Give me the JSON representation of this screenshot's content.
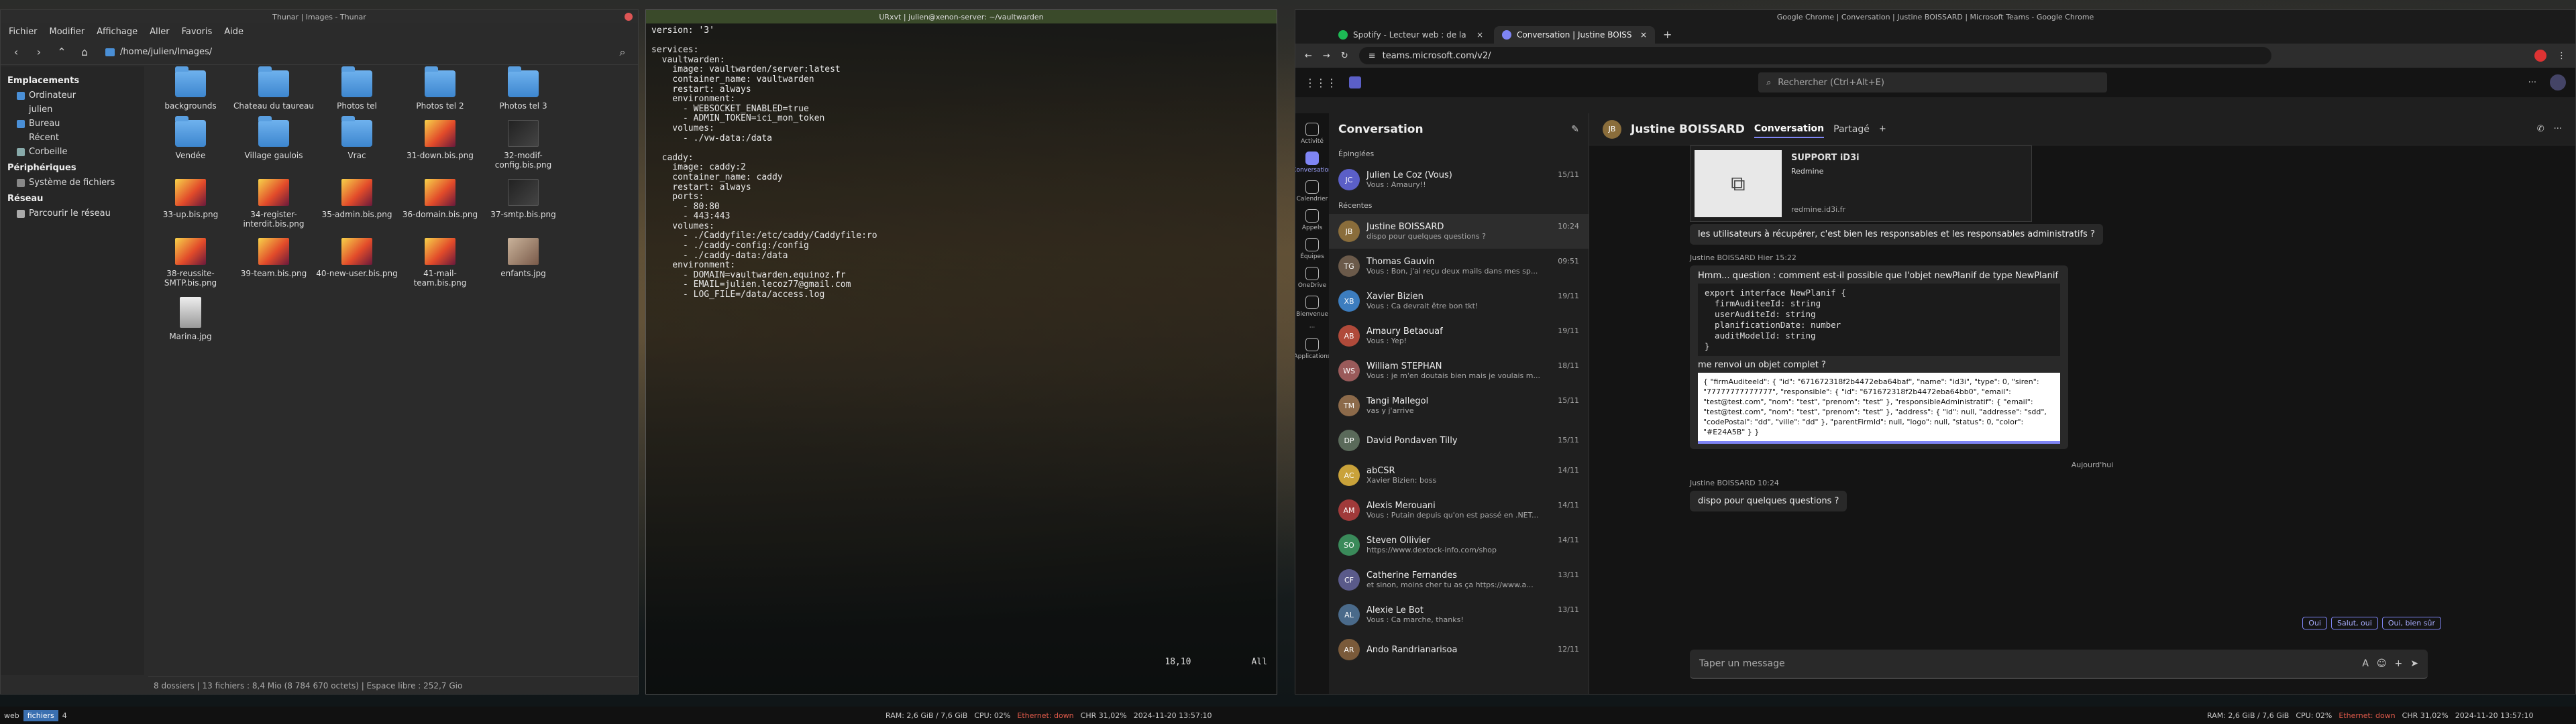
{
  "thunar": {
    "title": "Thunar | Images - Thunar",
    "menu": [
      "Fichier",
      "Modifier",
      "Affichage",
      "Aller",
      "Favoris",
      "Aide"
    ],
    "path": "/home/julien/Images/",
    "sidebar": {
      "places_title": "Emplacements",
      "places": [
        "Ordinateur",
        "julien",
        "Bureau",
        "Récent",
        "Corbeille"
      ],
      "devices_title": "Périphériques",
      "devices": [
        "Système de fichiers"
      ],
      "network_title": "Réseau",
      "network": [
        "Parcourir le réseau"
      ]
    },
    "files": [
      {
        "name": "backgrounds",
        "kind": "folder"
      },
      {
        "name": "Chateau du taureau",
        "kind": "folder"
      },
      {
        "name": "Photos tel",
        "kind": "folder"
      },
      {
        "name": "Photos tel 2",
        "kind": "folder"
      },
      {
        "name": "Photos tel 3",
        "kind": "folder"
      },
      {
        "name": "",
        "kind": "none"
      },
      {
        "name": "Vendée",
        "kind": "folder"
      },
      {
        "name": "Village gaulois",
        "kind": "folder"
      },
      {
        "name": "Vrac",
        "kind": "folder"
      },
      {
        "name": "31-down.bis.png",
        "kind": "img"
      },
      {
        "name": "32-modif-config.bis.png",
        "kind": "dark"
      },
      {
        "name": "",
        "kind": "none"
      },
      {
        "name": "33-up.bis.png",
        "kind": "img"
      },
      {
        "name": "34-register-interdit.bis.png",
        "kind": "img"
      },
      {
        "name": "35-admin.bis.png",
        "kind": "img"
      },
      {
        "name": "36-domain.bis.png",
        "kind": "img"
      },
      {
        "name": "37-smtp.bis.png",
        "kind": "dark"
      },
      {
        "name": "",
        "kind": "none"
      },
      {
        "name": "38-reussite-SMTP.bis.png",
        "kind": "img"
      },
      {
        "name": "39-team.bis.png",
        "kind": "img"
      },
      {
        "name": "40-new-user.bis.png",
        "kind": "img"
      },
      {
        "name": "41-mail-team.bis.png",
        "kind": "img"
      },
      {
        "name": "enfants.jpg",
        "kind": "photo"
      },
      {
        "name": "",
        "kind": "none"
      },
      {
        "name": "Marina.jpg",
        "kind": "portrait"
      }
    ],
    "status": "8 dossiers | 13 fichiers : 8,4 Mio (8 784 670 octets) | Espace libre : 252,7 Gio"
  },
  "terminal": {
    "title": "URxvt | julien@xenon-server: ~/vaultwarden",
    "content": "version: '3'\n\nservices:\n  vaultwarden:\n    image: vaultwarden/server:latest\n    container_name: vaultwarden\n    restart: always\n    environment:\n      - WEBSOCKET_ENABLED=true\n      - ADMIN_TOKEN=ici_mon_token\n    volumes:\n      - ./vw-data:/data\n\n  caddy:\n    image: caddy:2\n    container_name: caddy\n    restart: always\n    ports:\n      - 80:80\n      - 443:443\n    volumes:\n      - ./Caddyfile:/etc/caddy/Caddyfile:ro\n      - ./caddy-config:/config\n      - ./caddy-data:/data\n    environment:\n      - DOMAIN=vaultwarden.equinoz.fr\n      - EMAIL=julien.lecoz77@gmail.com\n      - LOG_FILE=/data/access.log",
    "position": "18,10",
    "scroll": "All"
  },
  "chrome": {
    "title": "Google Chrome | Conversation | Justine BOISSARD | Microsoft Teams - Google Chrome",
    "tabs": [
      "Spotify - Lecteur web : de la",
      "Conversation | Justine BOISS"
    ],
    "url": "teams.microsoft.com/v2/"
  },
  "teams": {
    "search_placeholder": "Rechercher (Ctrl+Alt+E)",
    "rail": [
      "Activité",
      "Conversation",
      "Calendrier",
      "Appels",
      "Équipes",
      "OneDrive",
      "Bienvenue",
      "Applications"
    ],
    "list_title": "Conversation",
    "pinned_label": "Épinglées",
    "recent_label": "Récentes",
    "pinned": [
      {
        "initials": "JC",
        "name": "Julien Le Coz (Vous)",
        "preview": "Vous : Amaury!!",
        "time": "15/11",
        "color": "#5b5fc7"
      }
    ],
    "chats": [
      {
        "initials": "JB",
        "name": "Justine BOISSARD",
        "preview": "dispo pour quelques questions ?",
        "time": "10:24",
        "color": "#8a6d3b"
      },
      {
        "initials": "TG",
        "name": "Thomas Gauvin",
        "preview": "Vous : Bon, j'ai reçu deux mails dans mes sp...",
        "time": "09:51",
        "color": "#6b5a4a"
      },
      {
        "initials": "XB",
        "name": "Xavier Bizien",
        "preview": "Vous : Ca devrait être bon tkt!",
        "time": "19/11",
        "color": "#3c7dbf"
      },
      {
        "initials": "AB",
        "name": "Amaury Betaouaf",
        "preview": "Vous : Yep!",
        "time": "19/11",
        "color": "#b04a3a"
      },
      {
        "initials": "WS",
        "name": "William STEPHAN",
        "preview": "Vous : je m'en doutais bien mais je voulais m...",
        "time": "18/11",
        "color": "#9a5a5a"
      },
      {
        "initials": "TM",
        "name": "Tangi Mallegol",
        "preview": "vas y j'arrive",
        "time": "15/11",
        "color": "#8c6a4a"
      },
      {
        "initials": "DP",
        "name": "David Pondaven Tilly",
        "preview": "",
        "time": "15/11",
        "color": "#5a6a5a"
      },
      {
        "initials": "AC",
        "name": "abCSR",
        "preview": "Xavier Bizien: boss",
        "time": "14/11",
        "color": "#c9a23a"
      },
      {
        "initials": "AM",
        "name": "Alexis Merouani",
        "preview": "Vous : Putain depuis qu'on est passé en .NET...",
        "time": "14/11",
        "color": "#a03a3a"
      },
      {
        "initials": "SO",
        "name": "Steven Ollivier",
        "preview": "https://www.dextock-info.com/shop",
        "time": "14/11",
        "color": "#3a8a5a"
      },
      {
        "initials": "CF",
        "name": "Catherine Fernandes",
        "preview": "et sinon, moins cher tu as ça https://www.a...",
        "time": "13/11",
        "color": "#5a5a8a"
      },
      {
        "initials": "AL",
        "name": "Alexie Le Bot",
        "preview": "Vous : Ca marche, thanks!",
        "time": "13/11",
        "color": "#4a6a8a"
      },
      {
        "initials": "AR",
        "name": "Ando Randrianarisoa",
        "preview": "",
        "time": "12/11",
        "color": "#7a5a3a"
      }
    ],
    "conv": {
      "initials": "JB",
      "name": "Justine BOISSARD",
      "tab_conv": "Conversation",
      "tab_share": "Partagé",
      "card_title": "SUPPORT iD3i",
      "card_sub": "Redmine",
      "card_url": "redmine.id3i.fr",
      "msg1": "les utilisateurs à récupérer, c'est bien les responsables et les responsables administratifs ?",
      "meta2": "Justine BOISSARD  Hier 15:22",
      "msg2": "Hmm... question : comment est-il possible que l'objet newPlanif de type NewPlanif",
      "code": "export interface NewPlanif {\n  firmAuditeeId: string\n  userAuditeId: string\n  planificationDate: number\n  auditModelId: string\n}",
      "msg3": "me renvoi un objet complet ?",
      "json_shot": "{ \"firmAuditeeId\": { \"id\": \"671672318f2b4472eba64baf\", \"name\": \"id3i\", \"type\": 0, \"siren\": \"77777777777777\", \"responsible\": { \"id\": \"671672318f2b4472eba64bb0\", \"email\": \"test@test.com\", \"nom\": \"test\", \"prenom\": \"test\" }, \"responsibleAdministratif\": { \"email\": \"test@test.com\", \"nom\": \"test\", \"prenom\": \"test\" }, \"address\": { \"id\": null, \"addresse\": \"sdd\", \"codePostal\": \"dd\", \"ville\": \"dd\" }, \"parentFirmId\": null, \"logo\": null, \"status\": 0, \"color\": \"#E24A5B\" } }",
      "today": "Aujourd'hui",
      "meta4": "Justine BOISSARD  10:24",
      "msg4": "dispo pour quelques questions ?",
      "suggestions": [
        "Oui",
        "Salut, oui",
        "Oui, bien sûr"
      ],
      "compose_placeholder": "Taper un message"
    }
  },
  "panel": {
    "workspaces": [
      "web",
      "fichiers",
      "4"
    ],
    "active_ws": "fichiers",
    "left_stats": {
      "ram": "RAM: 2,6 GiB / 7,6 GiB",
      "cpu": "CPU: 02%",
      "eth": "Ethernet: down",
      "chr": "CHR 31,02%",
      "date": "2024-11-20 13:57:10"
    },
    "right_stats": {
      "ram": "RAM: 2,6 GiB / 7,6 GiB",
      "cpu": "CPU: 02%",
      "eth": "Ethernet: down",
      "chr": "CHR 31,02%",
      "date": "2024-11-20 13:57:10"
    }
  }
}
